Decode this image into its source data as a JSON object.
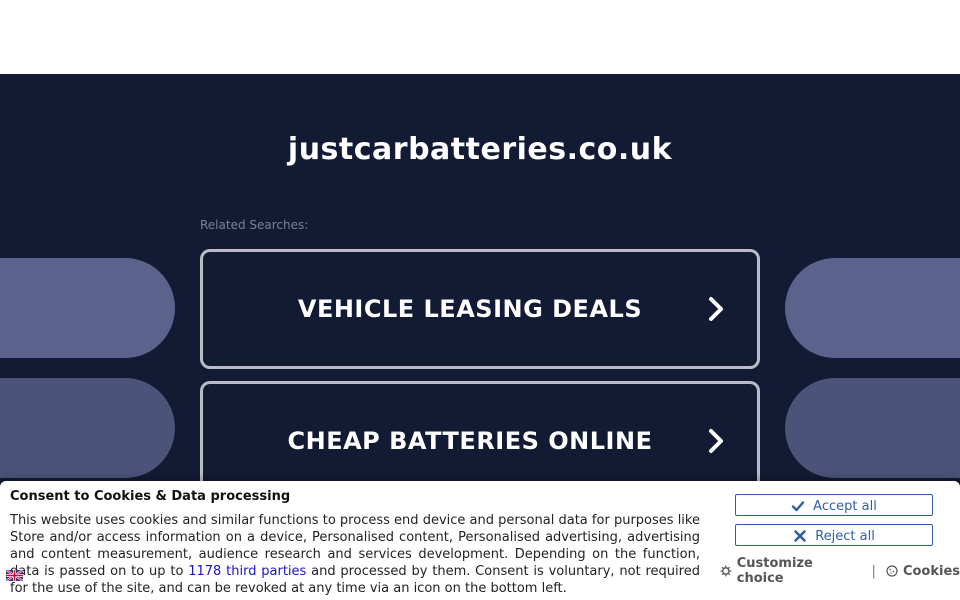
{
  "site": {
    "title": "justcarbatteries.co.uk",
    "related_label": "Related Searches:"
  },
  "searches": [
    {
      "label": "VEHICLE LEASING DEALS",
      "icon": "chevron-right-icon"
    },
    {
      "label": "CHEAP BATTERIES ONLINE",
      "icon": "chevron-right-icon"
    }
  ],
  "consent": {
    "title": "Consent to Cookies & Data processing",
    "text_before": "This website uses cookies and similar functions to process end device and personal data for purposes like Store and/or access information on a device, Personalised content, Personalised advertising, advertising and content measurement, audience research and services development. Depending on the function, data is passed on to up to ",
    "third_parties_link": "1178 third parties",
    "text_after": " and processed by them. Consent is voluntary, not required for the use of the site, and can be revoked at any time via an icon on the bottom left.",
    "accept_label": "Accept all",
    "reject_label": "Reject all",
    "customize_label": "Customize choice",
    "cookies_label": "Cookies",
    "separator": "|"
  },
  "colors": {
    "background": "#131a33",
    "button_border": "#2f5fa8",
    "link": "#1a14c4"
  }
}
